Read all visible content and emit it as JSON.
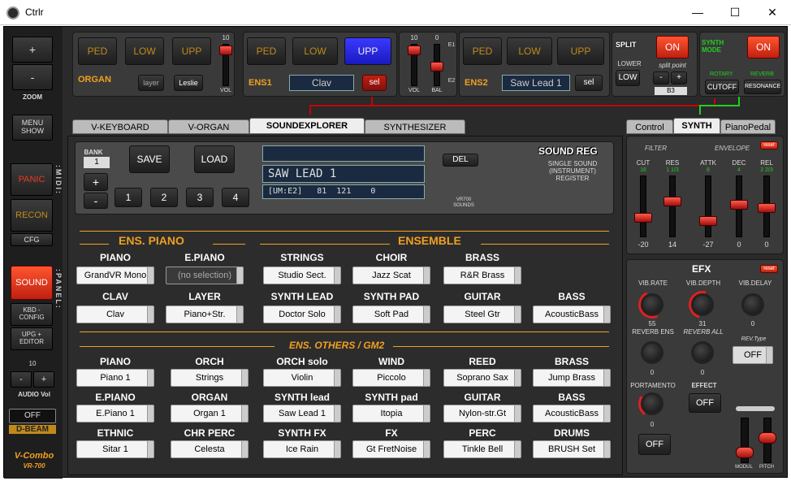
{
  "window": {
    "title": "Ctrlr",
    "min": "—",
    "max": "☐",
    "close": "✕"
  },
  "left": {
    "zoom_plus": "+",
    "zoom_minus": "-",
    "zoom": "ZOOM",
    "menu_show": "MENU\nSHOW",
    "panic": "PANIC",
    "recon": "RECON",
    "cfg": "CFG",
    "midi": ":MIDI:",
    "panel": ":PANEL:",
    "sound": "SOUND",
    "kbd_config": "KBD - CONFIG",
    "upg_editor": "UPG + EDITOR",
    "audio_val": "10",
    "audio_minus": "-",
    "audio_plus": "+",
    "audio_vol": "AUDIO Vol",
    "dbeam_off": "OFF",
    "dbeam": "D-BEAM",
    "brand": "V-Combo",
    "model": "VR-700"
  },
  "organ": {
    "ped": "PED",
    "low": "LOW",
    "upp": "UPP",
    "label": "ORGAN",
    "layer": "layer",
    "leslie": "Leslie",
    "vol_max": "10",
    "vol": "VOL"
  },
  "mid": {
    "vol_top": "10",
    "bal_top": "0",
    "e1": "E1",
    "e2": "E2",
    "vol": "VOL",
    "bal": "BAL"
  },
  "ens1": {
    "ped": "PED",
    "low": "LOW",
    "upp": "UPP",
    "label": "ENS1",
    "display": "Clav",
    "sel": "sel"
  },
  "ens2": {
    "ped": "PED",
    "low": "LOW",
    "upp": "UPP",
    "label": "ENS2",
    "display": "Saw Lead 1",
    "sel": "sel"
  },
  "split": {
    "title": "SPLIT",
    "on": "ON",
    "lower": "LOWER",
    "low": "LOW",
    "split_point": "split point",
    "minus": "-",
    "plus": "+",
    "note": "B3"
  },
  "synthmode": {
    "title": "SYNTH MODE",
    "on": "ON",
    "rotary": "ROTARY",
    "reverb": "REVERB",
    "cutoff": "CUTOFF",
    "resonance": "RESONANCE"
  },
  "tabs": [
    "V-KEYBOARD",
    "V-ORGAN",
    "SOUNDEXPLORER",
    "SYNTHESIZER"
  ],
  "righttabs": [
    "Control",
    "SYNTH",
    "PianoPedal"
  ],
  "soundreg": {
    "bank": "BANK",
    "bank_val": "1",
    "save": "SAVE",
    "load": "LOAD",
    "plus": "+",
    "minus": "-",
    "slots": [
      "1",
      "2",
      "3",
      "4"
    ],
    "del": "DEL",
    "title": "SOUND REG",
    "subtitle": "SINGLE SOUND (INSTRUMENT) REGISTER",
    "display_name": "SAW LEAD 1",
    "display_info": "[UM:E2]   81  121    0",
    "vr700": "VR700 SOUNDS"
  },
  "ens_piano": "ENS. PIANO",
  "ensemble": "ENSEMBLE",
  "ens_others": "ENS. OTHERS / GM2",
  "row1": [
    {
      "cat": "PIANO",
      "val": "GrandVR Mono"
    },
    {
      "cat": "E.PIANO",
      "val": "(no selection)"
    },
    {
      "cat": "STRINGS",
      "val": "Studio Sect."
    },
    {
      "cat": "CHOIR",
      "val": "Jazz Scat"
    },
    {
      "cat": "BRASS",
      "val": "R&R Brass"
    }
  ],
  "row2": [
    {
      "cat": "CLAV",
      "val": "Clav"
    },
    {
      "cat": "LAYER",
      "val": "Piano+Str."
    },
    {
      "cat": "SYNTH LEAD",
      "val": "Doctor Solo"
    },
    {
      "cat": "SYNTH PAD",
      "val": "Soft Pad"
    },
    {
      "cat": "GUITAR",
      "val": "Steel Gtr"
    },
    {
      "cat": "BASS",
      "val": "AcousticBass"
    }
  ],
  "row3": [
    {
      "cat": "PIANO",
      "val": "Piano 1"
    },
    {
      "cat": "ORCH",
      "val": "Strings"
    },
    {
      "cat": "ORCH solo",
      "val": "Violin"
    },
    {
      "cat": "WIND",
      "val": "Piccolo"
    },
    {
      "cat": "REED",
      "val": "Soprano Sax"
    },
    {
      "cat": "BRASS",
      "val": "Jump Brass"
    }
  ],
  "row4": [
    {
      "cat": "E.PIANO",
      "val": "E.Piano 1"
    },
    {
      "cat": "ORGAN",
      "val": "Organ 1"
    },
    {
      "cat": "SYNTH lead",
      "val": "Saw Lead 1"
    },
    {
      "cat": "SYNTH pad",
      "val": "Itopia"
    },
    {
      "cat": "GUITAR",
      "val": "Nylon-str.Gt"
    },
    {
      "cat": "BASS",
      "val": "AcousticBass"
    }
  ],
  "row5": [
    {
      "cat": "ETHNIC",
      "val": "Sitar 1"
    },
    {
      "cat": "CHR PERC",
      "val": "Celesta"
    },
    {
      "cat": "SYNTH FX",
      "val": "Ice Rain"
    },
    {
      "cat": "FX",
      "val": "Gt FretNoise"
    },
    {
      "cat": "PERC",
      "val": "Tinkle Bell"
    },
    {
      "cat": "DRUMS",
      "val": "BRUSH Set"
    }
  ],
  "filter": {
    "filter": "FILTER",
    "envelope": "ENVELOPE",
    "reset": "reset",
    "cols": [
      {
        "name": "CUT",
        "sub": "16",
        "val": "-20"
      },
      {
        "name": "RES",
        "sub": "1 1/3",
        "val": "14"
      },
      {
        "name": "ATTK",
        "sub": "8",
        "val": "-27"
      },
      {
        "name": "DEC",
        "sub": "4",
        "val": "0"
      },
      {
        "name": "REL",
        "sub": "2 2/3",
        "val": "0"
      }
    ]
  },
  "efx": {
    "title": "EFX",
    "reset": "reset",
    "vib_rate": "VIB.RATE",
    "vib_depth": "VIB.DEPTH",
    "vib_delay": "VIB.DELAY",
    "vib_rate_val": "55",
    "vib_depth_val": "31",
    "vib_delay_val": "0",
    "reverb_ens": "REVERB ENS",
    "reverb_all": "REVERB ALL",
    "rev_type": "REV.Type",
    "rev_type_val": "OFF",
    "reverb_ens_val": "0",
    "reverb_all_val": "0",
    "portamento": "PORTAMENTO",
    "portamento_val": "0",
    "effect": "EFFECT",
    "effect_off": "OFF",
    "porta_off": "OFF",
    "modul": "MODUL",
    "pitch": "PITCH"
  }
}
